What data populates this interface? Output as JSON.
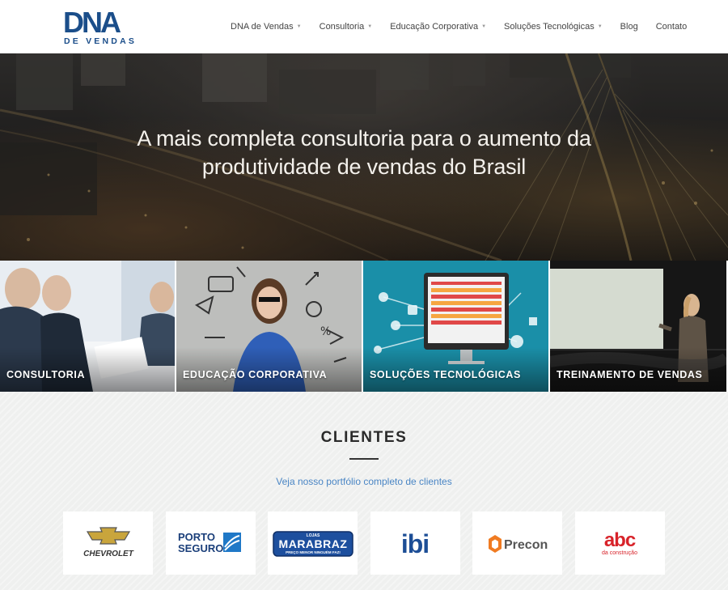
{
  "brand": {
    "logo_main": "DNA",
    "logo_sub": "DE VENDAS",
    "color": "#1b4e8a"
  },
  "nav": {
    "items": [
      {
        "label": "DNA de Vendas",
        "dropdown": true
      },
      {
        "label": "Consultoria",
        "dropdown": true
      },
      {
        "label": "Educação Corporativa",
        "dropdown": true
      },
      {
        "label": "Soluções Tecnológicas",
        "dropdown": true
      },
      {
        "label": "Blog",
        "dropdown": false
      },
      {
        "label": "Contato",
        "dropdown": false
      }
    ],
    "caret_icon": "caret-down-icon"
  },
  "hero": {
    "line1": "A mais completa consultoria para o aumento da",
    "line2": "produtividade de vendas do Brasil"
  },
  "tiles": [
    {
      "label": "CONSULTORIA",
      "accent": "#dfe8f1"
    },
    {
      "label": "EDUCAÇÃO CORPORATIVA",
      "accent": "#b9bab8"
    },
    {
      "label": "SOLUÇÕES TECNOLÓGICAS",
      "accent": "#1a8fa8"
    },
    {
      "label": "TREINAMENTO DE VENDAS",
      "accent": "#1b1b1b"
    }
  ],
  "clients": {
    "title": "CLIENTES",
    "link": "Veja nosso portfólio completo de clientes",
    "link_color": "#4a86c5",
    "logos": [
      {
        "name": "CHEVROLET",
        "icon": "chevrolet-bowtie-icon"
      },
      {
        "name": "PORTO",
        "name2": "SEGURO",
        "icon": "porto-seguro-icon"
      },
      {
        "name": "MARABRAZ",
        "top": "LOJAS",
        "tagline": "PREÇO MENOR NINGUÉM FAZ!",
        "icon": "marabraz-logo"
      },
      {
        "name": "ibi",
        "icon": "ibi-logo"
      },
      {
        "name": "Precon",
        "icon": "precon-cube-icon"
      },
      {
        "name": "abc",
        "tagline": "da construção",
        "icon": "abc-logo"
      }
    ]
  }
}
